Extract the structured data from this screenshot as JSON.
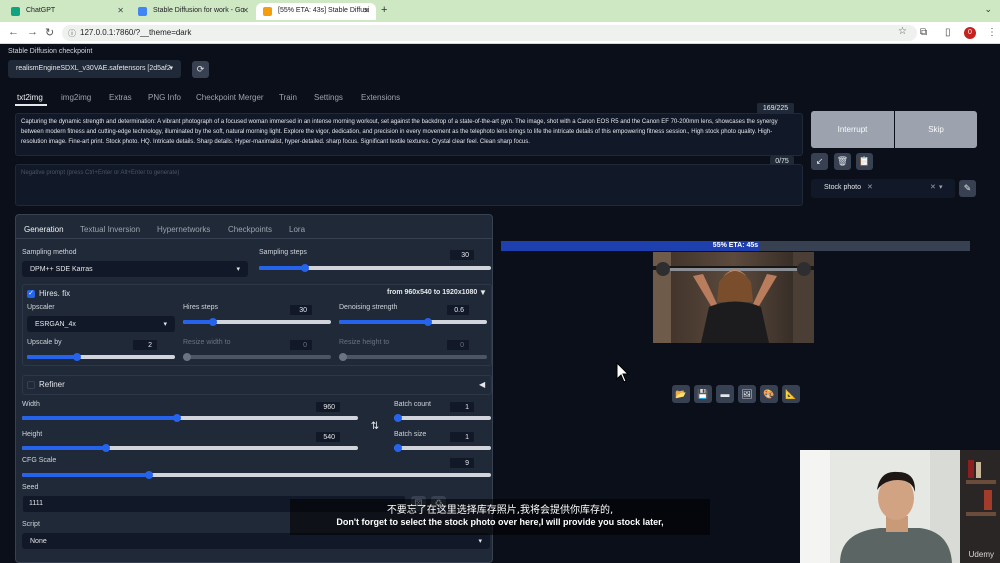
{
  "browser": {
    "tabs": [
      {
        "title": "ChatGPT",
        "favicon_color": "#10a37f"
      },
      {
        "title": "Stable Diffusion for work - Go",
        "favicon_color": "#4285f4"
      },
      {
        "title": "[55% ETA: 43s] Stable Diffusi",
        "favicon_color": "#f59e0b"
      }
    ],
    "new_tab": "+",
    "url": "127.0.0.1:7860/?__theme=dark",
    "profile_initial": "0"
  },
  "checkpoint": {
    "label": "Stable Diffusion checkpoint",
    "value": "realismEngineSDXL_v30VAE.safetensors [2d5af2"
  },
  "nav_tabs": [
    "txt2img",
    "img2img",
    "Extras",
    "PNG Info",
    "Checkpoint Merger",
    "Train",
    "Settings",
    "Extensions"
  ],
  "prompt": {
    "text": "Capturing the dynamic strength and determination: A vibrant photograph of a focused woman immersed in an intense morning workout, set against the backdrop of a state-of-the-art gym. The image, shot with a Canon EOS R5 and the Canon EF 70-200mm lens, showcases the synergy between modern fitness and cutting-edge technology, illuminated by the soft, natural morning light. Explore the vigor, dedication, and precision in every movement as the telephoto lens brings to life the intricate details of this empowering fitness session., High stock photo quality. High-resolution image. Fine-art print. Stock photo. HQ. Intricate details. Sharp details. Hyper-maximalist, hyper-detailed. sharp focus. Significant textile textures. Crystal clear feel. Clean sharp focus.",
    "token_count": "169/225"
  },
  "negative_prompt": {
    "placeholder": "Negative prompt (press Ctrl+Enter or Alt+Enter to generate)",
    "token_count": "0/75"
  },
  "actions": {
    "interrupt": "Interrupt",
    "skip": "Skip"
  },
  "styles": {
    "selected": "Stock photo"
  },
  "sub_tabs": [
    "Generation",
    "Textual Inversion",
    "Hypernetworks",
    "Checkpoints",
    "Lora"
  ],
  "sampling": {
    "method_label": "Sampling method",
    "method_value": "DPM++ SDE Karras",
    "steps_label": "Sampling steps",
    "steps_value": "30",
    "steps_fraction": 0.2
  },
  "hires": {
    "label": "Hires. fix",
    "checked": true,
    "resize_info": "from 960x540  to 1920x1080",
    "upscaler_label": "Upscaler",
    "upscaler_value": "ESRGAN_4x",
    "steps_label": "Hires steps",
    "steps_value": "30",
    "steps_fraction": 0.2,
    "denoise_label": "Denoising strength",
    "denoise_value": "0.6",
    "denoise_fraction": 0.6,
    "upscale_by_label": "Upscale by",
    "upscale_by_value": "2",
    "upscale_by_fraction": 0.34,
    "resize_width_label": "Resize width to",
    "resize_width_value": "0",
    "resize_height_label": "Resize height to",
    "resize_height_value": "0"
  },
  "refiner": {
    "label": "Refiner"
  },
  "dimensions": {
    "width_label": "Width",
    "width_value": "960",
    "width_fraction": 0.46,
    "height_label": "Height",
    "height_value": "540",
    "height_fraction": 0.25,
    "batch_count_label": "Batch count",
    "batch_count_value": "1",
    "batch_size_label": "Batch size",
    "batch_size_value": "1"
  },
  "cfg": {
    "label": "CFG Scale",
    "value": "9",
    "fraction": 0.27
  },
  "seed": {
    "label": "Seed",
    "value": "1111"
  },
  "script": {
    "label": "Script",
    "value": "None"
  },
  "progress": {
    "text": "55% ETA: 45s",
    "fraction": 0.55
  },
  "output_icons": [
    "folder-icon",
    "save-icon",
    "zip-icon",
    "image-icon",
    "palette-icon",
    "extras-icon"
  ],
  "subtitles": {
    "zh": "不要忘了在这里选择库存照片,我将会提供你库存的,",
    "en": "Don't forget to select the stock photo over here,I will provide you stock later,"
  },
  "watermark": "Udemy",
  "colors": {
    "accent": "#2563eb",
    "progress": "#1e3a8a",
    "button": "#9ca3af",
    "background": "#0b0f19",
    "panel": "#1f2937"
  }
}
